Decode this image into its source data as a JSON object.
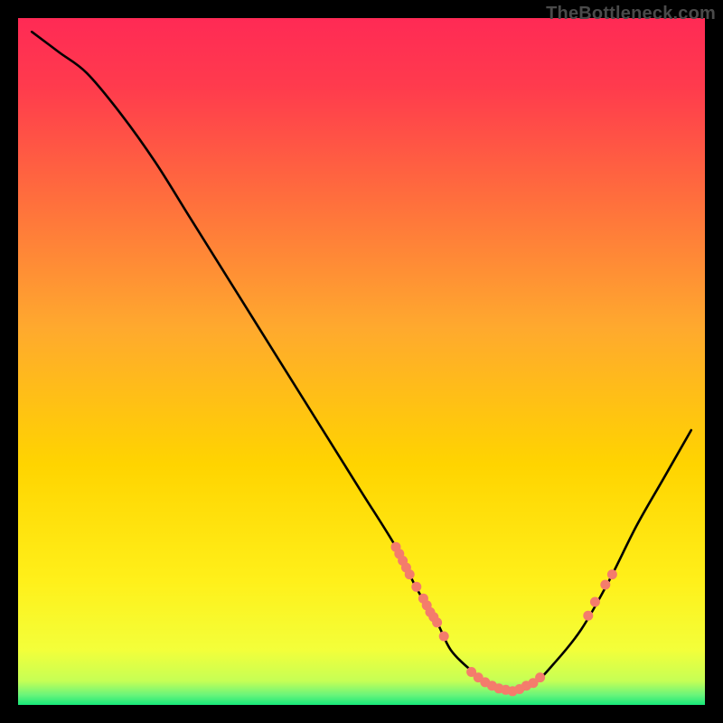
{
  "watermark": "TheBottleneck.com",
  "chart_data": {
    "type": "line",
    "title": "",
    "xlabel": "",
    "ylabel": "",
    "xlim": [
      0,
      100
    ],
    "ylim": [
      0,
      100
    ],
    "grid": false,
    "legend": false,
    "background_gradient": {
      "top": "#ff2a55",
      "mid": "#ffd400",
      "bottom_band": "#17e87a"
    },
    "series": [
      {
        "name": "bottleneck-curve",
        "x": [
          2,
          6,
          10,
          15,
          20,
          25,
          30,
          35,
          40,
          45,
          50,
          55,
          58,
          61,
          63,
          66,
          69,
          72,
          75,
          78,
          82,
          86,
          90,
          94,
          98
        ],
        "y": [
          98,
          95,
          92,
          86,
          79,
          71,
          63,
          55,
          47,
          39,
          31,
          23,
          17,
          12,
          8,
          5,
          3,
          2,
          3,
          6,
          11,
          18,
          26,
          33,
          40
        ]
      }
    ],
    "markers": [
      {
        "name": "cluster-left-descent",
        "x": 55.0,
        "y": 23.0
      },
      {
        "name": "cluster-left-descent",
        "x": 55.5,
        "y": 22.0
      },
      {
        "name": "cluster-left-descent",
        "x": 56.0,
        "y": 21.0
      },
      {
        "name": "cluster-left-descent",
        "x": 56.5,
        "y": 20.0
      },
      {
        "name": "cluster-left-descent",
        "x": 57.0,
        "y": 19.0
      },
      {
        "name": "cluster-left-descent",
        "x": 58.0,
        "y": 17.2
      },
      {
        "name": "cluster-mid-descent",
        "x": 59.0,
        "y": 15.5
      },
      {
        "name": "cluster-mid-descent",
        "x": 59.5,
        "y": 14.5
      },
      {
        "name": "cluster-mid-descent",
        "x": 60.0,
        "y": 13.5
      },
      {
        "name": "cluster-mid-descent",
        "x": 60.5,
        "y": 12.8
      },
      {
        "name": "cluster-mid-descent",
        "x": 61.0,
        "y": 12.0
      },
      {
        "name": "cluster-mid-descent",
        "x": 62.0,
        "y": 10.0
      },
      {
        "name": "cluster-valley",
        "x": 66.0,
        "y": 4.8
      },
      {
        "name": "cluster-valley",
        "x": 67.0,
        "y": 4.0
      },
      {
        "name": "cluster-valley",
        "x": 68.0,
        "y": 3.3
      },
      {
        "name": "cluster-valley",
        "x": 69.0,
        "y": 2.8
      },
      {
        "name": "cluster-valley",
        "x": 70.0,
        "y": 2.4
      },
      {
        "name": "cluster-valley",
        "x": 71.0,
        "y": 2.2
      },
      {
        "name": "cluster-valley",
        "x": 72.0,
        "y": 2.0
      },
      {
        "name": "cluster-valley",
        "x": 73.0,
        "y": 2.3
      },
      {
        "name": "cluster-valley",
        "x": 74.0,
        "y": 2.8
      },
      {
        "name": "cluster-valley",
        "x": 75.0,
        "y": 3.2
      },
      {
        "name": "cluster-valley",
        "x": 76.0,
        "y": 4.0
      },
      {
        "name": "cluster-right-ascent",
        "x": 83.0,
        "y": 13.0
      },
      {
        "name": "cluster-right-ascent",
        "x": 84.0,
        "y": 15.0
      },
      {
        "name": "cluster-right-ascent",
        "x": 85.5,
        "y": 17.5
      },
      {
        "name": "cluster-right-ascent",
        "x": 86.5,
        "y": 19.0
      }
    ]
  }
}
